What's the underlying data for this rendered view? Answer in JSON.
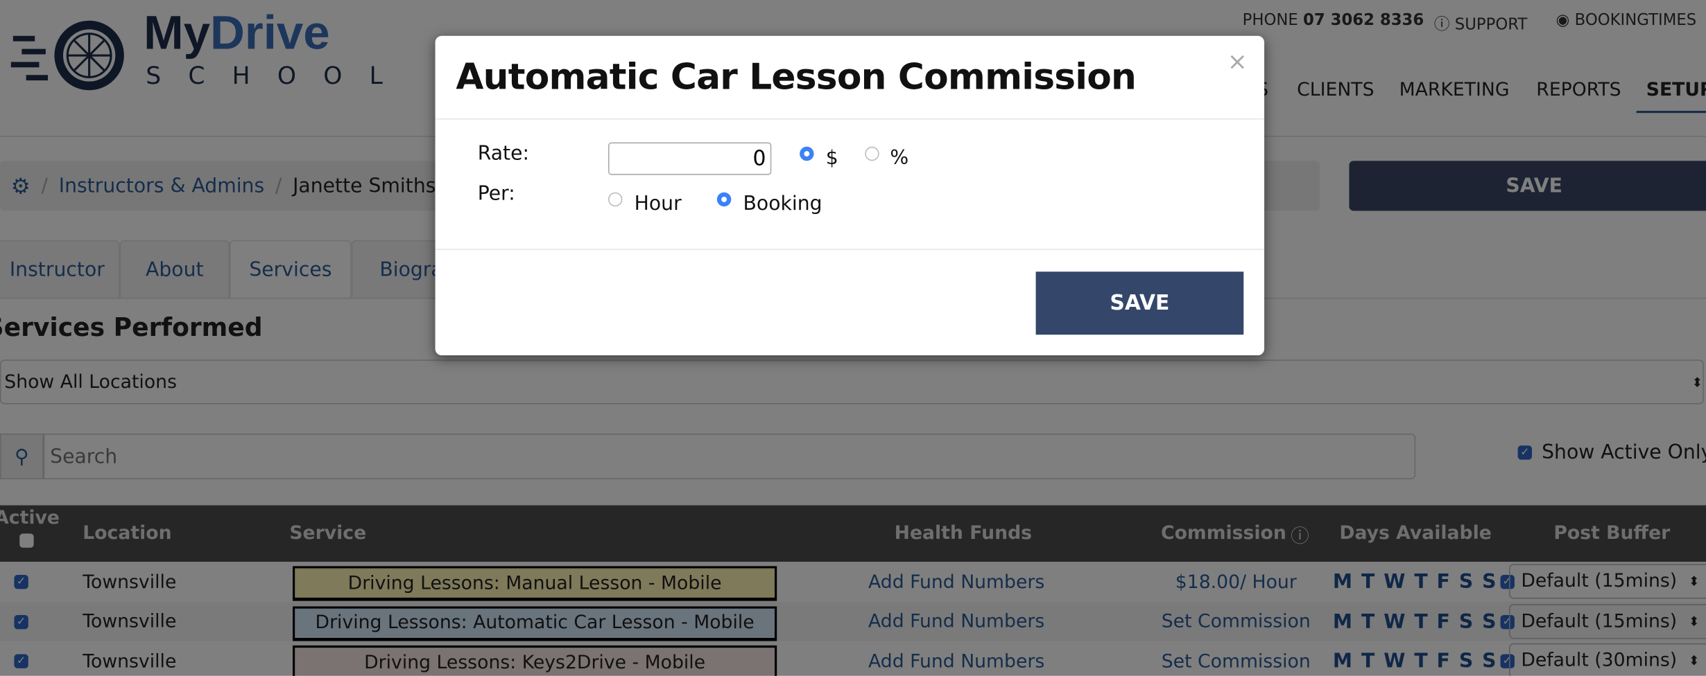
{
  "header": {
    "logo_text_1": "My",
    "logo_text_2": "Drive",
    "logo_text_3": "SCHOOL",
    "phone_label": "PHONE",
    "phone_number": "07 3062 8336",
    "support": "SUPPORT",
    "account": "BOOKINGTIMES",
    "nav": [
      "S",
      "CLIENTS",
      "MARKETING",
      "REPORTS",
      "SETUP"
    ],
    "active_nav": "SETUP"
  },
  "breadcrumb": {
    "items": [
      "Instructors & Admins",
      "Janette Smiths"
    ],
    "separator": "/"
  },
  "save_label": "SAVE",
  "tabs": [
    {
      "label": "Instructor"
    },
    {
      "label": "About"
    },
    {
      "label": "Services",
      "active": true
    },
    {
      "label": "Biogra"
    }
  ],
  "section_title": "Services Performed",
  "location_select": {
    "value": "Show All Locations"
  },
  "search": {
    "placeholder": "Search",
    "value": ""
  },
  "show_active_only": {
    "label": "Show Active Only",
    "checked": true
  },
  "table": {
    "headers": [
      "Active",
      "Location",
      "Service",
      "Health Funds",
      "Commission",
      "Days Available",
      "Post Buffer"
    ],
    "rows": [
      {
        "active": true,
        "location": "Townsville",
        "service": "Driving Lessons: Manual Lesson - Mobile",
        "service_color": "#fdf5b4",
        "health_funds": "Add Fund Numbers",
        "commission": "$18.00/ Hour",
        "days": "M T W T F S S",
        "buffer": "Default (15mins)"
      },
      {
        "active": true,
        "location": "Townsville",
        "service": "Driving Lessons: Automatic Car Lesson - Mobile",
        "service_color": "#d5e8fa",
        "health_funds": "Add Fund Numbers",
        "commission": "Set Commission",
        "days": "M T W T F S S",
        "buffer": "Default (15mins)"
      },
      {
        "active": true,
        "location": "Townsville",
        "service": "Driving Lessons: Keys2Drive - Mobile",
        "service_color": "#f4e6e4",
        "health_funds": "Add Fund Numbers",
        "commission": "Set Commission",
        "days": "M T W T F S S",
        "buffer": "Default (30mins)"
      }
    ]
  },
  "modal": {
    "title": "Automatic Car Lesson Commission",
    "close": "×",
    "rate_label": "Rate:",
    "rate_value": "0",
    "rate_unit_options": [
      "$",
      "%"
    ],
    "rate_unit_selected": "$",
    "per_label": "Per:",
    "per_options": [
      "Hour",
      "Booking"
    ],
    "per_selected": "Booking",
    "save_label": "SAVE"
  },
  "colors": {
    "accent": "#2b5b97",
    "button": "#34466a",
    "table_header": "#4c4c4c"
  }
}
